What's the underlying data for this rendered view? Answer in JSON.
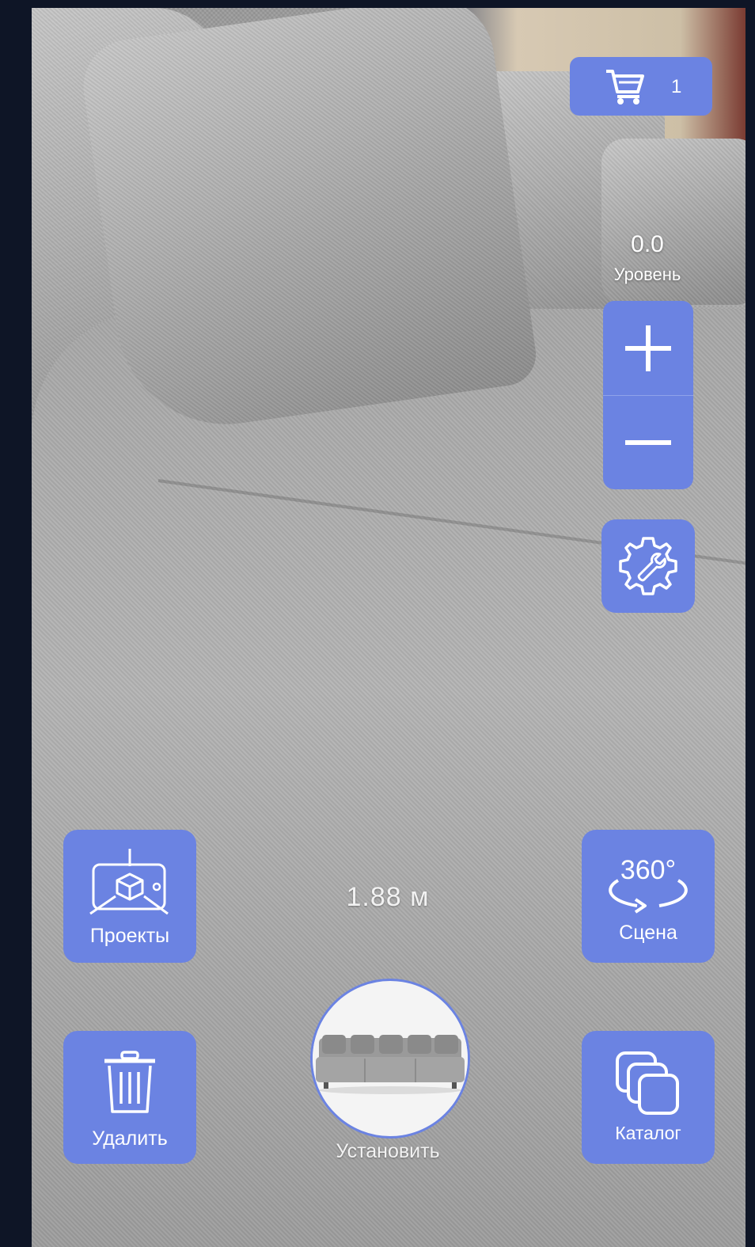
{
  "cart": {
    "count": "1",
    "icon": "cart-icon"
  },
  "level": {
    "value": "0.0",
    "label": "Уровень"
  },
  "zoom": {
    "plus_icon": "plus-icon",
    "minus_icon": "minus-icon"
  },
  "settings": {
    "icon": "gear-wrench-icon"
  },
  "projects": {
    "label": "Проекты",
    "icon": "ar-cube-phone-icon"
  },
  "scene": {
    "label": "Сцена",
    "icon": "rotate-360-icon",
    "icon_text": "360°"
  },
  "delete": {
    "label": "Удалить",
    "icon": "trash-icon"
  },
  "catalog": {
    "label": "Каталог",
    "icon": "stacked-cards-icon"
  },
  "measurement": {
    "value": "1.88",
    "unit": "м",
    "display": "1.88  м"
  },
  "place": {
    "label": "Установить",
    "thumbnail": "sofa-thumbnail"
  },
  "colors": {
    "accent": "#6b83e2",
    "text": "#ffffff",
    "frame": "#0e1526"
  }
}
